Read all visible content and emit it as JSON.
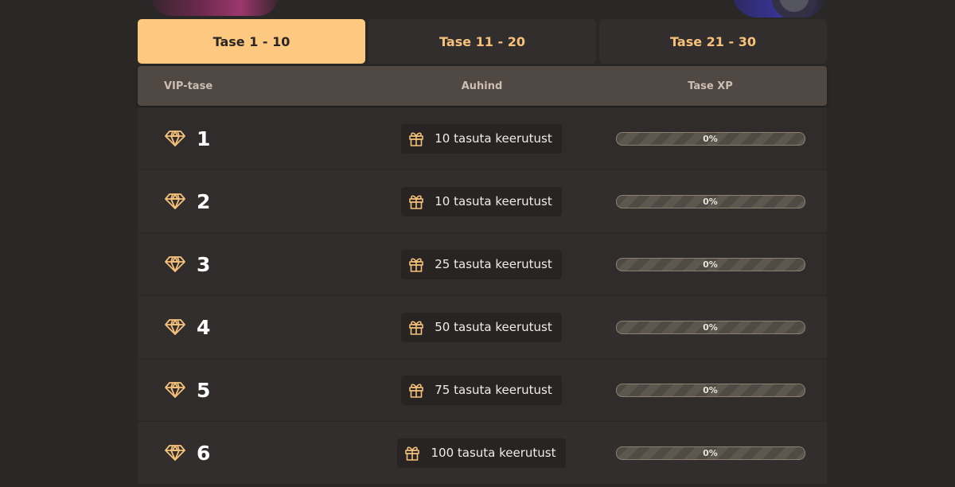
{
  "tabs": [
    {
      "label": "Tase 1 - 10",
      "active": true
    },
    {
      "label": "Tase 11 - 20",
      "active": false
    },
    {
      "label": "Tase 21 - 30",
      "active": false
    }
  ],
  "table": {
    "headers": {
      "vip": "VIP-tase",
      "prize": "Auhind",
      "xp": "Tase XP"
    },
    "rows": [
      {
        "level": "1",
        "prize": "10 tasuta keerutust",
        "xp": "0%"
      },
      {
        "level": "2",
        "prize": "10 tasuta keerutust",
        "xp": "0%"
      },
      {
        "level": "3",
        "prize": "25 tasuta keerutust",
        "xp": "0%"
      },
      {
        "level": "4",
        "prize": "50 tasuta keerutust",
        "xp": "0%"
      },
      {
        "level": "5",
        "prize": "75 tasuta keerutust",
        "xp": "0%"
      },
      {
        "level": "6",
        "prize": "100 tasuta keerutust",
        "xp": "0%"
      }
    ]
  },
  "icons": {
    "vip": "diamond-icon",
    "prize": "gift-icon"
  },
  "colors": {
    "accent": "#fdc87f",
    "tab_text": "#f6c27a",
    "header_bg": "#504843",
    "row_bg": "#322e2e"
  }
}
